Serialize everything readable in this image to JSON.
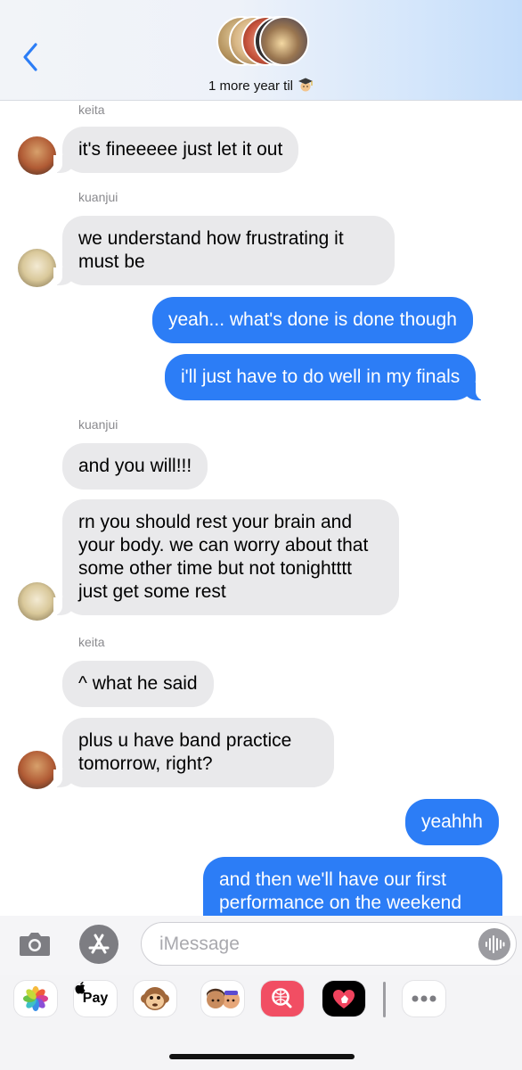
{
  "header": {
    "group_title": "1 more year til",
    "title_emoji_icon": "graduate-emoji-icon"
  },
  "messages": [
    {
      "id": "m1",
      "sender": "keita",
      "direction": "incoming",
      "text": "it's fineeeee just let it out"
    },
    {
      "id": "m2",
      "sender": "kuanjui",
      "direction": "incoming",
      "text": "we understand how frustrating it must be"
    },
    {
      "id": "m3",
      "sender": "me",
      "direction": "outgoing",
      "text": "yeah... what's done is done though"
    },
    {
      "id": "m4",
      "sender": "me",
      "direction": "outgoing",
      "text": "i'll just have to do well in my finals"
    },
    {
      "id": "m5",
      "sender": "kuanjui",
      "direction": "incoming",
      "text": "and you will!!!"
    },
    {
      "id": "m6",
      "sender": "kuanjui",
      "direction": "incoming",
      "text": "rn you should rest your brain and your body. we can worry about that some other time but not tonightttt just get some rest"
    },
    {
      "id": "m7",
      "sender": "keita",
      "direction": "incoming",
      "text": "^ what he said"
    },
    {
      "id": "m8",
      "sender": "keita",
      "direction": "incoming",
      "text": "plus u have band practice tomorrow, right?"
    },
    {
      "id": "m9",
      "sender": "me",
      "direction": "outgoing",
      "text": "yeahhh"
    },
    {
      "id": "m10",
      "sender": "me",
      "direction": "outgoing",
      "text": "and then we'll have our first performance on the weekend"
    }
  ],
  "sender_labels": {
    "keita": "keita",
    "kuanjui": "kuanjui"
  },
  "compose": {
    "placeholder": "iMessage",
    "value": ""
  },
  "app_strip": {
    "apps": [
      "photos-icon",
      "apple-pay-icon",
      "animoji-icon",
      "memoji-icon",
      "image-search-icon",
      "digital-touch-icon",
      "more-apps-icon"
    ],
    "apple_pay_label": "Pay"
  },
  "colors": {
    "outgoing_bubble": "#2c7df6",
    "incoming_bubble": "#e9e9eb",
    "accent": "#2c7df6"
  }
}
